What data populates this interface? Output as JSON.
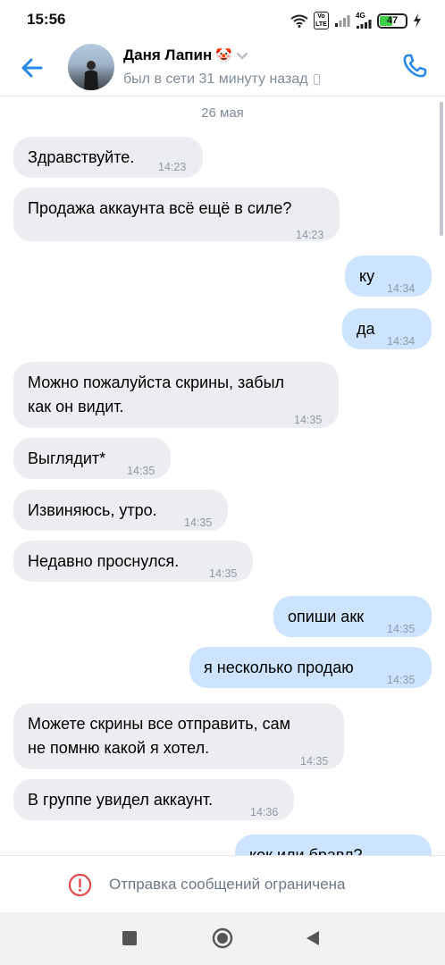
{
  "status_bar": {
    "time": "15:56",
    "network_vo": "Vo LTE",
    "network_type": "4G",
    "battery": "47",
    "icons": [
      "wifi-icon",
      "signal-icon",
      "battery-icon",
      "charging-icon"
    ]
  },
  "header": {
    "name": "Даня Лапин",
    "name_emoji": "🤡",
    "status": "был в сети 31 минуту назад",
    "icons": [
      "back-arrow-icon",
      "chevron-down-icon",
      "mobile-phone-icon",
      "call-icon"
    ]
  },
  "chat": {
    "date": "26 мая",
    "messages": [
      {
        "dir": "in",
        "text": "Здравствуйте.",
        "time": "14:23"
      },
      {
        "dir": "in",
        "text": "Продажа аккаунта всё ещё в силе?",
        "time": "14:23"
      },
      {
        "dir": "out",
        "text": "ку",
        "time": "14:34"
      },
      {
        "dir": "out",
        "text": "да",
        "time": "14:34"
      },
      {
        "dir": "in",
        "text": "Можно пожалуйста скрины, забыл\nкак он видит.",
        "time": "14:35"
      },
      {
        "dir": "in",
        "text": "Выглядит*",
        "time": "14:35"
      },
      {
        "dir": "in",
        "text": "Извиняюсь, утро.",
        "time": "14:35"
      },
      {
        "dir": "in",
        "text": "Недавно проснулся.",
        "time": "14:35"
      },
      {
        "dir": "out",
        "text": "опиши акк",
        "time": "14:35"
      },
      {
        "dir": "out",
        "text": "я несколько продаю",
        "time": "14:35"
      },
      {
        "dir": "in",
        "text": "Можете скрины все отправить, сам\nне помню какой я хотел.",
        "time": "14:35"
      },
      {
        "dir": "in",
        "text": "В группе увидел аккаунт.",
        "time": "14:36"
      },
      {
        "dir": "out",
        "text": "кок или бравл?",
        "time": ""
      }
    ]
  },
  "restriction": {
    "text": "Отправка сообщений ограничена",
    "icon": "warning-circle-icon",
    "color": "#e64646"
  },
  "nav_bar": {
    "icons": [
      "recents-square-icon",
      "home-circle-icon",
      "back-triangle-icon"
    ]
  },
  "colors": {
    "accent": "#2688eb",
    "incoming_bubble": "#ebedf0",
    "outgoing_bubble": "#cce4ff"
  }
}
